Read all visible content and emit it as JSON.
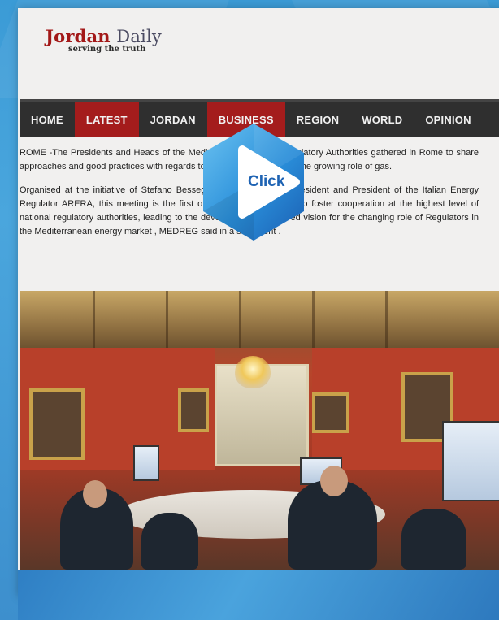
{
  "brand": {
    "name_accent": "Jordan",
    "name_rest": "Daily",
    "tagline": "serving the truth"
  },
  "nav": {
    "items": [
      {
        "label": "HOME",
        "active": false
      },
      {
        "label": "LATEST",
        "active": true
      },
      {
        "label": "JORDAN",
        "active": false
      },
      {
        "label": "BUSINESS",
        "active": true
      },
      {
        "label": "REGION",
        "active": false
      },
      {
        "label": "WORLD",
        "active": false
      },
      {
        "label": "OPINION",
        "active": false
      }
    ]
  },
  "article": {
    "p1": "ROME -The Presidents and Heads of the Mediterranean Energy Regulatory Authorities gathered in Rome to share approaches and good practices with regards to renewable energy and the growing role of gas.",
    "p2": "Organised at the initiative of Stefano Besseghini, MEDREG Vice President and President of the Italian Energy Regulator ARERA, this meeting is the first of its kind and is meant to foster cooperation at the highest level of national regulatory authorities, leading to the development of a shared vision for the changing role of Regulators in the Mediterranean energy market , MEDREG said in a statement ."
  },
  "overlay": {
    "play_label": "Click",
    "icon": "play-icon"
  },
  "colors": {
    "accent_red": "#a41c1c",
    "nav_bg": "#2f2f2f",
    "background_blue": "#3b9bd6"
  }
}
